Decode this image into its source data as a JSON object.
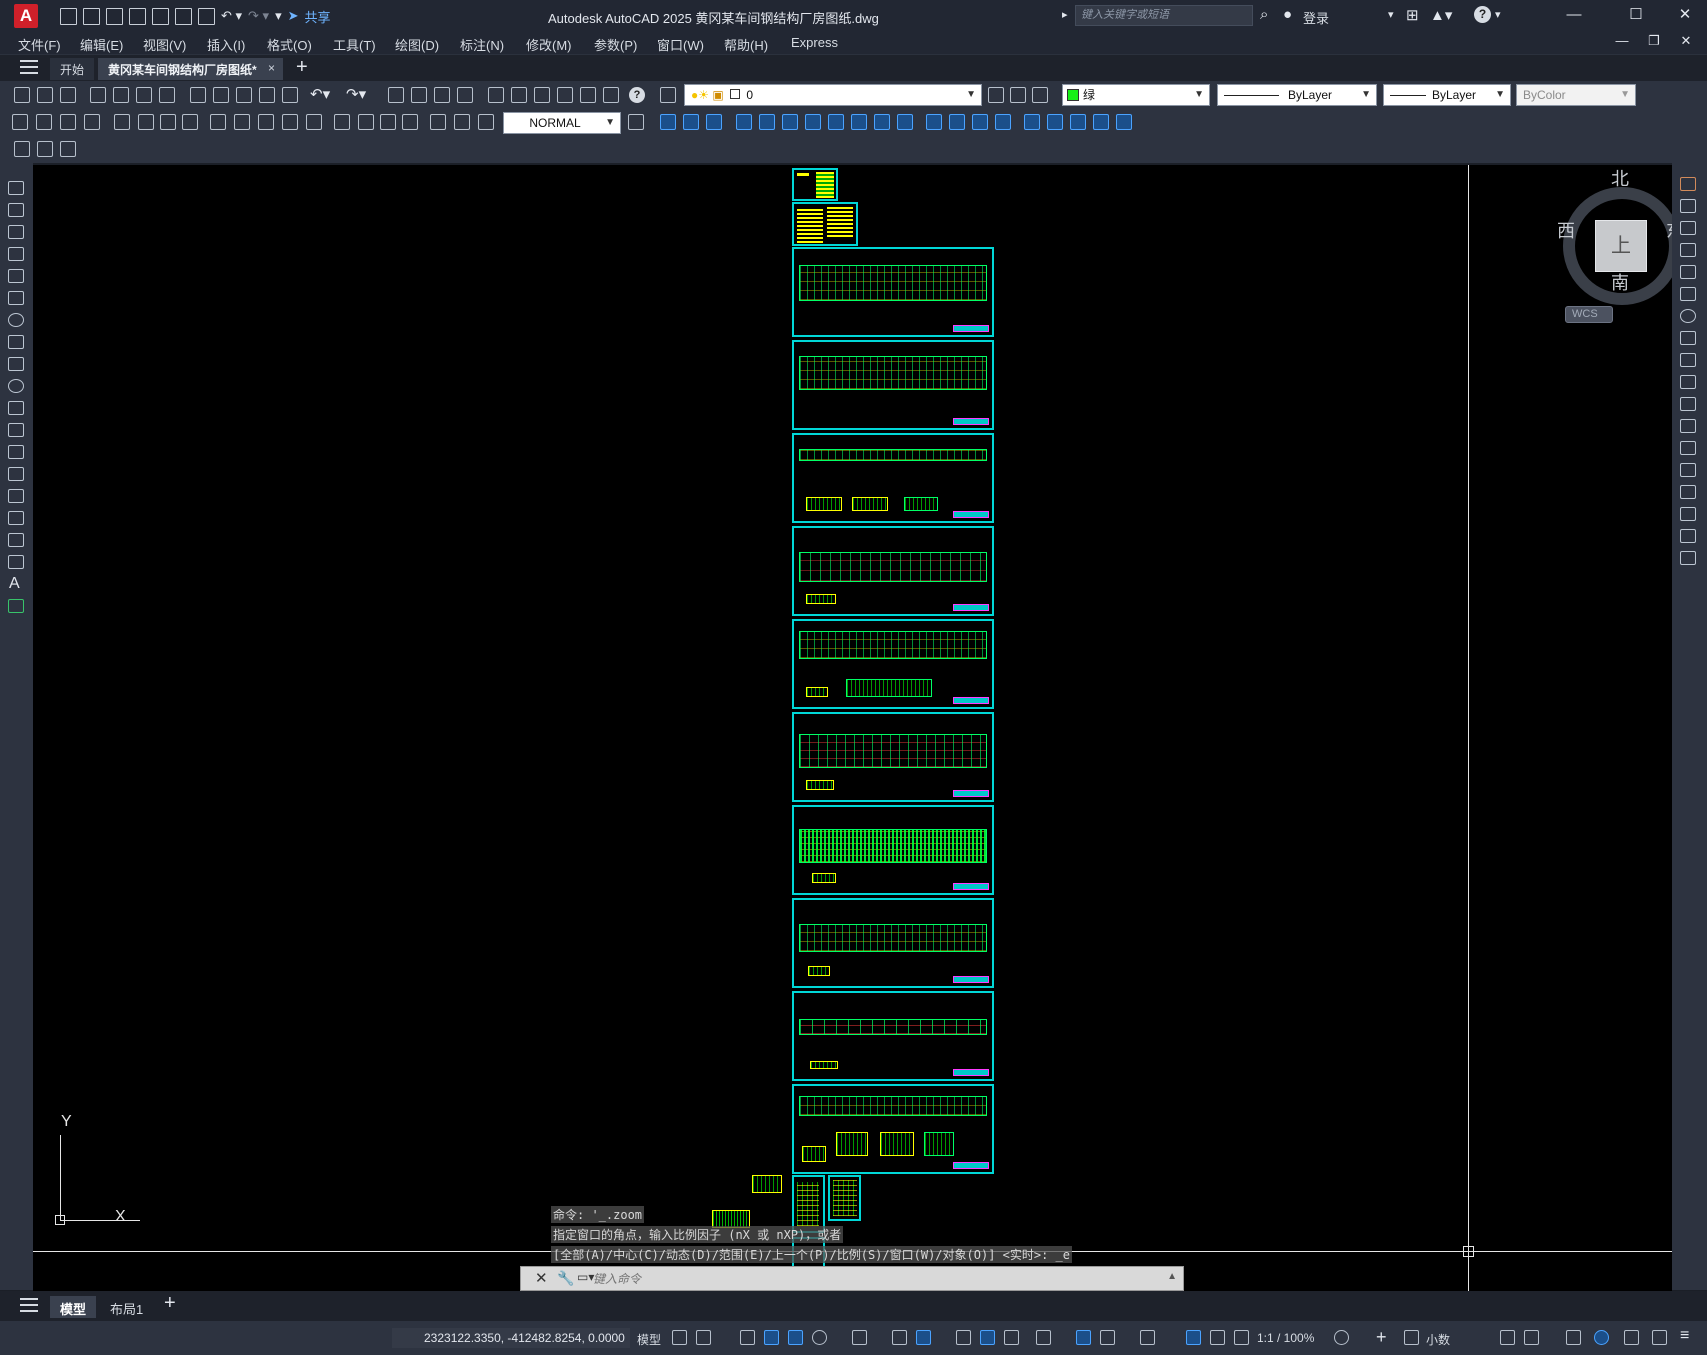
{
  "titlebar": {
    "logo": "A",
    "share_label": "共享",
    "window_title": "Autodesk AutoCAD 2025    黄冈某车间钢结构厂房图纸.dwg",
    "search_placeholder": "键入关键字或短语",
    "login_label": "登录",
    "help_label": "?"
  },
  "menu": [
    "文件(F)",
    "编辑(E)",
    "视图(V)",
    "插入(I)",
    "格式(O)",
    "工具(T)",
    "绘图(D)",
    "标注(N)",
    "修改(M)",
    "参数(P)",
    "窗口(W)",
    "帮助(H)",
    "Express"
  ],
  "doc_tabs": {
    "start": "开始",
    "active": "黄冈某车间钢结构厂房图纸*",
    "close": "×",
    "add": "+"
  },
  "properties": {
    "layer": "0",
    "color": "绿",
    "color_hex": "#17f017",
    "linetype": "ByLayer",
    "lineweight": "ByLayer",
    "plotstyle": "ByColor",
    "dimstyle": "NORMAL"
  },
  "viewcube": {
    "north": "北",
    "south": "南",
    "east": "东",
    "west": "西",
    "face": "上",
    "wcs": "WCS"
  },
  "ucs": {
    "x": "X",
    "y": "Y"
  },
  "command": {
    "history": [
      "命令: '_.zoom",
      "指定窗口的角点，输入比例因子 (nX 或 nXP)，或者",
      "[全部(A)/中心(C)/动态(D)/范围(E)/上一个(P)/比例(S)/窗口(W)/对象(O)] <实时>: _e"
    ],
    "placeholder": "键入命令"
  },
  "layout_tabs": {
    "model": "模型",
    "layout1": "布局1",
    "add": "+"
  },
  "status": {
    "coordinates": "2323122.3350, -412482.8254, 0.0000",
    "model_label": "模型",
    "scale": "1:1 / 100%",
    "units": "小数"
  },
  "accent_colors": {
    "sheet_border": "#00d7d7",
    "sheet_lines": "#00ff66",
    "annotation": "#ffff00",
    "titleblock": "#ff3bff"
  }
}
